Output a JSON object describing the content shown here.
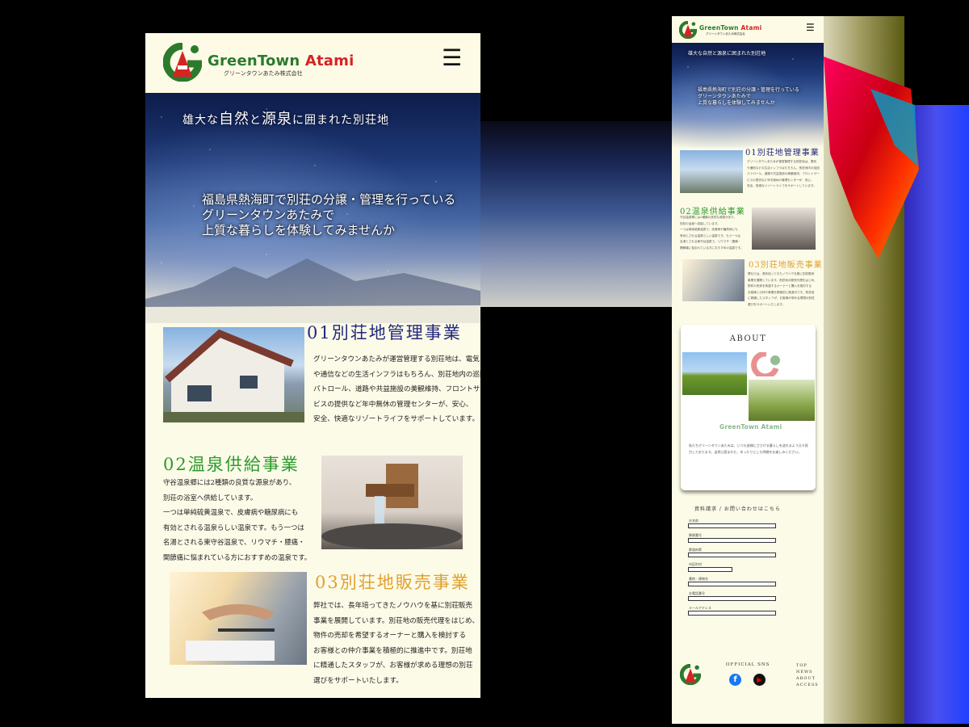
{
  "colors": {
    "brand_green": "#2c7a2c",
    "brand_red": "#d42424",
    "section1": "#22287e",
    "section2": "#2b9a2b",
    "section3": "#e0a030",
    "page_bg": "#fcfbe8"
  },
  "brand": {
    "name_1": "GreenTown ",
    "name_2": "Atami",
    "sub": "グリーンタウンあたみ株式会社",
    "mark": "GA",
    "logo_icon": "greentown-logo-icon"
  },
  "nav": {
    "menu_icon": "hamburger-icon",
    "menu_glyph": "☰"
  },
  "hero": {
    "title_1": "雄大な",
    "title_2": "自然",
    "title_3": "と",
    "title_4": "源泉",
    "title_5": "に囲まれた別荘地",
    "lead": [
      "福島県熱海町で別荘の分譲・管理を行っている",
      "グリーンタウンあたみで",
      "上質な暮らしを体験してみませんか"
    ]
  },
  "services": [
    {
      "title": "01別荘地管理事業",
      "photo_icon": "villa-house-photo",
      "body": [
        "グリーンタウンあたみが運営管理する別荘地は、電気",
        "や通信などの生活インフラはもちろん、別荘地内の巡回",
        "パトロール、道路や共益施設の美観維持、フロントサー",
        "ビスの提供など年中無休の管理センターが、安心、",
        "安全、快適なリゾートライフをサポートしています。"
      ]
    },
    {
      "title": "02温泉供給事業",
      "photo_icon": "hot-spring-spout-photo",
      "body": [
        "守谷温泉郷には2種類の良質な源泉があり、",
        "別荘の浴室へ供給しています。",
        "一つは単純硫黄温泉で、皮膚病や糖尿病にも",
        "有効とされる温泉らしい温泉です。もう一つは",
        "名湯とされる東守谷温泉で、リウマチ・腰痛・",
        "関節痛に悩まれている方におすすめの温泉です。"
      ]
    },
    {
      "title": "03別荘地販売事業",
      "photo_icon": "handshake-photo",
      "body": [
        "弊社では、長年培ってきたノウハウを基に別荘販売",
        "事業を展開しています。別荘地の販売代理をはじめ、",
        "物件の売却を希望するオーナーと購入を検討する",
        "お客様との仲介事業を積極的に推進中です。別荘地",
        "に精通したスタッフが、お客様が求める理想の別荘",
        "選びをサポートいたします。"
      ]
    }
  ],
  "about": {
    "heading": "ABOUT",
    "photo_icons": [
      "green-field-photo",
      "horse-on-meadow-photo"
    ],
    "body": "私たちグリーンタウンあたみは、いつも皆様にささげる暮らしを送れるよう日々努力しております。自然に囲まれた、ゆったりとした時間をお楽しみください。"
  },
  "contact": {
    "heading": "資料請求 / お問い合わせはこちら",
    "fields": [
      "お名前",
      "郵便番号",
      "都道府県",
      "市区町村",
      "番地・建物名",
      "お電話番号",
      "メールアドレス"
    ]
  },
  "footer": {
    "sns_label": "OFFICIAL SNS",
    "sns": [
      {
        "icon": "facebook-icon",
        "glyph": "f"
      },
      {
        "icon": "youtube-icon",
        "glyph": "▶"
      }
    ],
    "nav": [
      "TOP",
      "NEWS",
      "ABOUT",
      "ACCESS"
    ]
  }
}
